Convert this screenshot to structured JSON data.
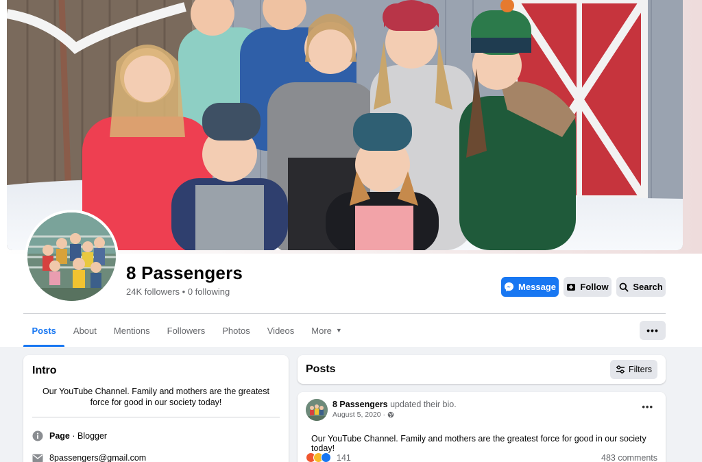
{
  "page": {
    "name": "8 Passengers",
    "followers_text": "24K followers • 0 following"
  },
  "actions": {
    "message": "Message",
    "follow": "Follow",
    "search": "Search"
  },
  "tabs": [
    {
      "label": "Posts",
      "active": true
    },
    {
      "label": "About"
    },
    {
      "label": "Mentions"
    },
    {
      "label": "Followers"
    },
    {
      "label": "Photos"
    },
    {
      "label": "Videos"
    },
    {
      "label": "More"
    }
  ],
  "intro": {
    "title": "Intro",
    "bio": "Our YouTube Channel. Family and mothers are the greatest force for good in our society today!",
    "category_label": "Page",
    "category_value": " · Blogger",
    "email": "8passengers@gmail.com"
  },
  "posts_section": {
    "title": "Posts",
    "filters": "Filters"
  },
  "post": {
    "author": "8 Passengers",
    "action": " updated their bio.",
    "date": "August 5, 2020 ·",
    "body": "Our YouTube Channel. Family and mothers are the greatest force for good in our society today!",
    "reaction_count": "141",
    "comments": "483 comments"
  },
  "colors": {
    "accent": "#1877f2",
    "button_gray": "#e4e6eb",
    "muted_text": "#65676b"
  }
}
